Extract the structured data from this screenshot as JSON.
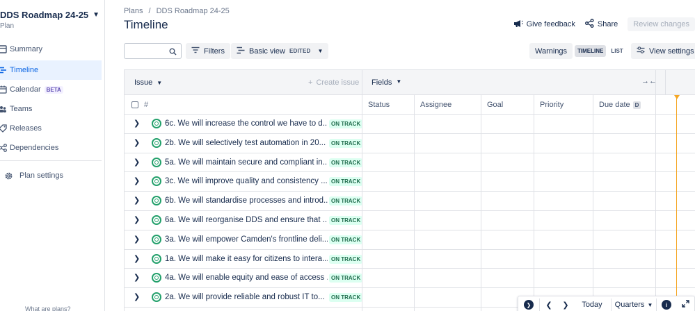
{
  "sidebar": {
    "plan_title": "DDS Roadmap 24-25",
    "plan_subtitle": "Plan",
    "items": [
      {
        "label": "Summary",
        "icon": "summary-icon",
        "active": false
      },
      {
        "label": "Timeline",
        "icon": "timeline-icon",
        "active": true
      },
      {
        "label": "Calendar",
        "icon": "calendar-icon",
        "active": false,
        "badge": "BETA"
      },
      {
        "label": "Teams",
        "icon": "teams-icon",
        "active": false
      },
      {
        "label": "Releases",
        "icon": "releases-icon",
        "active": false
      },
      {
        "label": "Dependencies",
        "icon": "dependencies-icon",
        "active": false
      }
    ],
    "settings_label": "Plan settings",
    "footer_label": "What are plans?"
  },
  "header": {
    "breadcrumb": [
      "Plans",
      "/",
      "DDS Roadmap 24-25"
    ],
    "title": "Timeline",
    "feedback_label": "Give feedback",
    "share_label": "Share",
    "review_label": "Review changes"
  },
  "toolbar": {
    "search_value": "",
    "filters_label": "Filters",
    "view_label": "Basic view",
    "view_badge": "EDITED",
    "warnings_label": "Warnings",
    "timeline_label": "TIMELINE",
    "list_label": "LIST",
    "view_settings_label": "View settings"
  },
  "grid": {
    "issue_header": "Issue",
    "create_issue_label": "Create issue",
    "fields_header": "Fields",
    "hash_label": "#",
    "columns": [
      "Status",
      "Assignee",
      "Goal",
      "Priority",
      "Due date"
    ],
    "due_date_key": "D",
    "rows": [
      {
        "title": "6c. We will increase the control we have to d...",
        "status": "ON TRACK"
      },
      {
        "title": "2b. We will selectively test automation in 20...",
        "status": "ON TRACK"
      },
      {
        "title": "5a. We will maintain secure and compliant in...",
        "status": "ON TRACK"
      },
      {
        "title": "3c. We will improve quality and consistency ...",
        "status": "ON TRACK"
      },
      {
        "title": "6b. We will standardise processes and introd...",
        "status": "ON TRACK"
      },
      {
        "title": "6a. We will reorganise DDS and ensure that ...",
        "status": "ON TRACK"
      },
      {
        "title": "3a. We will empower Camden's frontline deli...",
        "status": "ON TRACK"
      },
      {
        "title": "1a. We will make it easy for citizens to intera...",
        "status": "ON TRACK"
      },
      {
        "title": "4a. We will enable equity and ease of access ...",
        "status": "ON TRACK"
      },
      {
        "title": "2a. We will provide reliable and robust IT to...",
        "status": "ON TRACK"
      }
    ]
  },
  "bottom_nav": {
    "today_label": "Today",
    "zoom_label": "Quarters"
  },
  "colors": {
    "accent": "#0c66e4",
    "on_track_bg": "#dcfff1",
    "on_track_text": "#216e4e",
    "today_line": "#f5a623"
  }
}
